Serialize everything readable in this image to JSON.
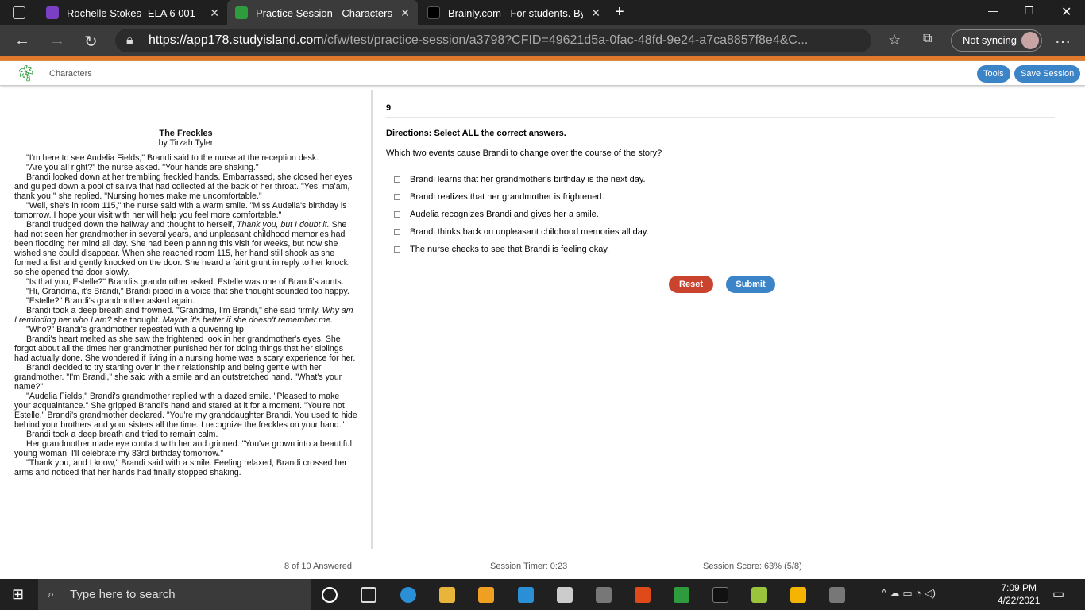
{
  "browser": {
    "tabs": [
      {
        "title": "Rochelle Stokes- ELA 6 001",
        "active": false,
        "icon_color": "#7b3fc4"
      },
      {
        "title": "Practice Session - Characters - St",
        "active": true,
        "icon_color": "#2e9b3c"
      },
      {
        "title": "Brainly.com - For students. By stu",
        "active": false,
        "icon_color": "#000000"
      }
    ],
    "url_host": "https://app178.studyisland.com",
    "url_path": "/cfw/test/practice-session/a3798?CFID=49621d5a-0fac-48fd-9e24-a7ca8857f8e4&C...",
    "sync_label": "Not syncing"
  },
  "app": {
    "section_title": "Characters",
    "tools_label": "Tools",
    "save_label": "Save Session",
    "accent": "#e07a2a"
  },
  "passage": {
    "title": "The Freckles",
    "author": "by Tirzah Tyler",
    "paragraphs": [
      "\"I'm here to see Audelia Fields,\" Brandi said to the nurse at the reception desk.",
      "\"Are you all right?\" the nurse asked. \"Your hands are shaking.\"",
      "Brandi looked down at her trembling freckled hands. Embarrassed, she closed her eyes and gulped down a pool of saliva that had collected at the back of her throat. \"Yes, ma'am, thank you,\" she replied. \"Nursing homes make me uncomfortable.\"",
      "\"Well, she's in room 115,\" the nurse said with a warm smile. \"Miss Audelia's birthday is tomorrow. I hope your visit with her will help you feel more comfortable.\"",
      "Brandi trudged down the hallway and thought to herself, <i>Thank you, but I doubt it.</i> She had not seen her grandmother in several years, and unpleasant childhood memories had been flooding her mind all day. She had been planning this visit for weeks, but now she wished she could disappear. When she reached room 115, her hand still shook as she formed a fist and gently knocked on the door. She heard a faint grunt in reply to her knock, so she opened the door slowly.",
      "\"Is that you, Estelle?\" Brandi's grandmother asked. Estelle was one of Brandi's aunts.",
      "\"Hi, Grandma, it's Brandi,\" Brandi piped in a voice that she thought sounded too happy.",
      "\"Estelle?\" Brandi's grandmother asked again.",
      "Brandi took a deep breath and frowned. \"Grandma, I'm Brandi,\" she said firmly. <i>Why am I reminding her who I am?</i> she thought. <i>Maybe it's better if she doesn't remember me.</i>",
      "\"Who?\" Brandi's grandmother repeated with a quivering lip.",
      "Brandi's heart melted as she saw the frightened look in her grandmother's eyes. She forgot about all the times her grandmother punished her for doing things that her siblings had actually done. She wondered if living in a nursing home was a scary experience for her.",
      "Brandi decided to try starting over in their relationship and being gentle with her grandmother. \"I'm Brandi,\" she said with a smile and an outstretched hand. \"What's your name?\"",
      "\"Audelia Fields,\" Brandi's grandmother replied with a dazed smile. \"Pleased to make your acquaintance.\" She gripped Brandi's hand and stared at it for a moment. \"You're not Estelle,\" Brandi's grandmother declared. \"You're my granddaughter Brandi. You used to hide behind your brothers and your sisters all the time. I recognize the freckles on your hand.\"",
      "Brandi took a deep breath and tried to remain calm.",
      "Her grandmother made eye contact with her and grinned. \"You've grown into a beautiful young woman. I'll celebrate my 83rd birthday tomorrow.\"",
      "\"Thank you, and I know,\" Brandi said with a smile. Feeling relaxed, Brandi crossed her arms and noticed that her hands had finally stopped shaking."
    ]
  },
  "question": {
    "number": "9",
    "directions": "Directions: Select ALL the correct answers.",
    "text": "Which two events cause Brandi to change over the course of the story?",
    "options": [
      {
        "label": "Brandi learns that her grandmother's birthday is the next day.",
        "checked": false
      },
      {
        "label": "Brandi realizes that her grandmother is frightened.",
        "checked": false
      },
      {
        "label": "Audelia recognizes Brandi and gives her a smile.",
        "checked": false
      },
      {
        "label": "Brandi thinks back on unpleasant childhood memories all day.",
        "checked": false
      },
      {
        "label": "The nurse checks to see that Brandi is feeling okay.",
        "checked": false
      }
    ],
    "reset_label": "Reset",
    "submit_label": "Submit"
  },
  "footer": {
    "answered": "8 of 10 Answered",
    "timer": "Session Timer: 0:23",
    "score": "Session Score: 63% (5/8)"
  },
  "taskbar": {
    "search_placeholder": "Type here to search",
    "time": "7:09 PM",
    "date": "4/22/2021"
  }
}
